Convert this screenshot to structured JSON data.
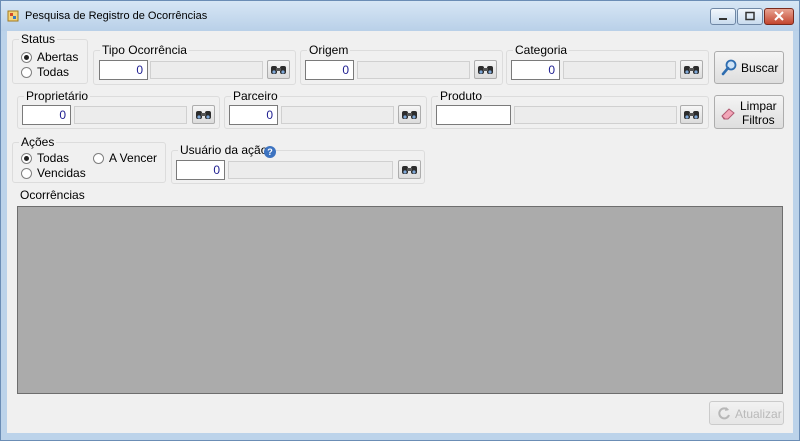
{
  "window": {
    "title": "Pesquisa de Registro de Ocorrências"
  },
  "status": {
    "label": "Status",
    "options": [
      "Abertas",
      "Todas"
    ],
    "selected": "Abertas"
  },
  "tipo_ocorrencia": {
    "label": "Tipo Ocorrência",
    "value": "0",
    "description": ""
  },
  "origem": {
    "label": "Origem",
    "value": "0",
    "description": ""
  },
  "categoria": {
    "label": "Categoria",
    "value": "0",
    "description": ""
  },
  "buscar": {
    "label": "Buscar"
  },
  "proprietario": {
    "label": "Proprietário",
    "value": "0",
    "description": ""
  },
  "parceiro": {
    "label": "Parceiro",
    "value": "0",
    "description": ""
  },
  "produto": {
    "label": "Produto",
    "value": "",
    "description": ""
  },
  "limpar": {
    "label_line1": "Limpar",
    "label_line2": "Filtros"
  },
  "acoes": {
    "label": "Ações",
    "options": [
      "Todas",
      "A Vencer",
      "Vencidas"
    ],
    "selected": "Todas"
  },
  "usuario_acao": {
    "label": "Usuário da ação",
    "value": "0",
    "description": "",
    "help_glyph": "?"
  },
  "ocorrencias": {
    "label": "Ocorrências",
    "rows": []
  },
  "atualizar": {
    "label": "Atualizar",
    "enabled": false
  },
  "icons": {
    "window": "app-icon",
    "lookup": "binoculars-icon",
    "search": "magnifier-icon",
    "clear": "eraser-icon",
    "refresh": "refresh-icon",
    "help": "help-icon"
  }
}
